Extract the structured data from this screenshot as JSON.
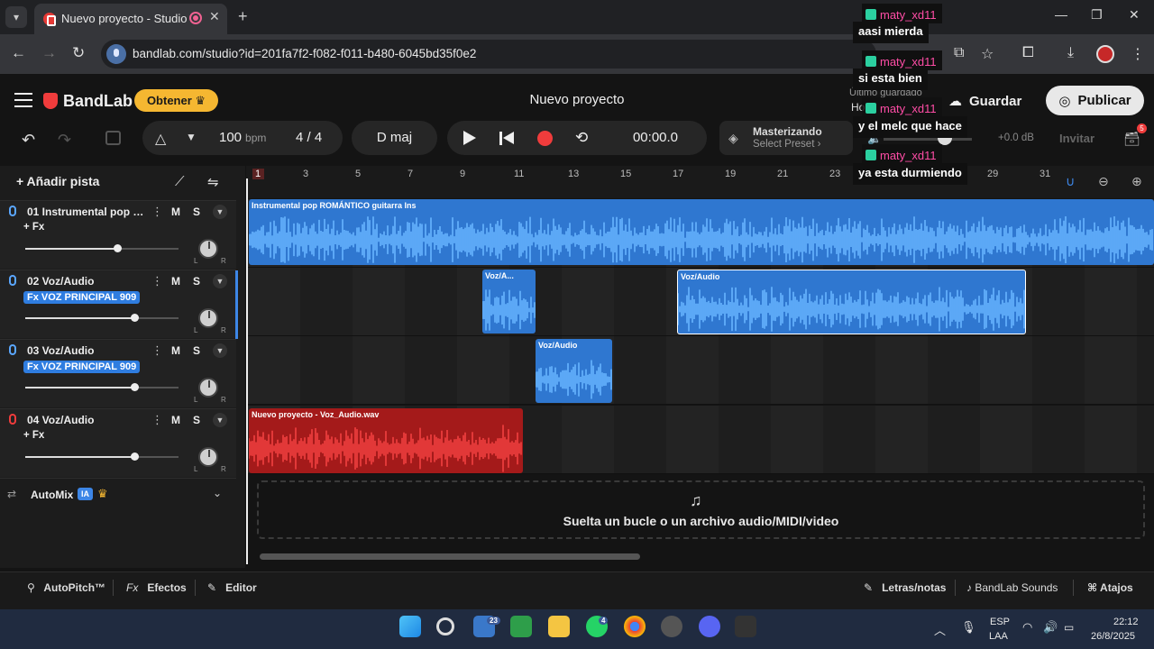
{
  "browser": {
    "tab_title": "Nuevo proyecto - Studio",
    "url": "bandlab.com/studio?id=201fa7f2-f082-f011-b480-6045bd35f0e2"
  },
  "header": {
    "brand": "BandLab",
    "obtener_label": "Obtener",
    "project_title": "Nuevo proyecto",
    "save_label": "Guardar",
    "publish_label": "Publicar",
    "ultimo_guardado": "Último guardado",
    "ghost_ho": "Ho"
  },
  "transport": {
    "bpm": "100",
    "bpm_unit": "bpm",
    "time_signature": "4 / 4",
    "key": "D maj",
    "time": "00:00.0",
    "master_title": "Masterizando",
    "master_preset": "Select Preset",
    "volume_db": "+0.0 dB",
    "invite_label": "Invitar",
    "cart_badge": "5"
  },
  "panel": {
    "add_track": "Añadir pista",
    "automix_label": "AutoMix",
    "automix_badge": "IA"
  },
  "tracks": [
    {
      "name": "01 Instrumental pop R...",
      "fx": "+ Fx",
      "fx_active": false,
      "volume": 0.6,
      "color": "#5aa7ff"
    },
    {
      "name": "02 Voz/Audio",
      "fx": "Fx VOZ PRINCIPAL 909",
      "fx_active": true,
      "volume": 0.71,
      "color": "#5aa7ff"
    },
    {
      "name": "03 Voz/Audio",
      "fx": "Fx VOZ PRINCIPAL 909",
      "fx_active": true,
      "volume": 0.71,
      "color": "#5aa7ff"
    },
    {
      "name": "04 Voz/Audio",
      "fx": "+ Fx",
      "fx_active": false,
      "volume": 0.71,
      "color": "#f03c3c"
    }
  ],
  "mute_label": "M",
  "solo_label": "S",
  "ruler_ticks": [
    "1",
    "3",
    "5",
    "7",
    "9",
    "11",
    "13",
    "15",
    "17",
    "19",
    "21",
    "23",
    "29",
    "31"
  ],
  "clips": [
    {
      "track": 0,
      "label": "Instrumental pop ROMÁNTICO guitarra  Ins"
    },
    {
      "track": 1,
      "label": "Voz/A..."
    },
    {
      "track": 1,
      "label": "Voz/Audio"
    },
    {
      "track": 2,
      "label": "Voz/Audio"
    },
    {
      "track": 3,
      "label": "Nuevo proyecto - Voz_Audio.wav"
    }
  ],
  "drop_zone_text": "Suelta un bucle o un archivo audio/MIDI/video",
  "bottom_bar": {
    "autopitch": "AutoPitch™",
    "efectos": "Efectos",
    "editor": "Editor",
    "letras": "Letras/notas",
    "sounds": "BandLab Sounds",
    "atajos": "Atajos"
  },
  "chat": [
    {
      "user": "maty_xd11",
      "message": "aasi mierda"
    },
    {
      "user": "maty_xd11",
      "message": "si esta bien"
    },
    {
      "user": "maty_xd11",
      "message": "y el melc que hace"
    },
    {
      "user": "maty_xd11",
      "message": "ya esta durmiendo"
    }
  ],
  "taskbar": {
    "badge_widgets": "23",
    "badge_whatsapp": "4",
    "lang": "ESP",
    "layout": "LAA",
    "time": "22:12",
    "date": "26/8/2025"
  }
}
